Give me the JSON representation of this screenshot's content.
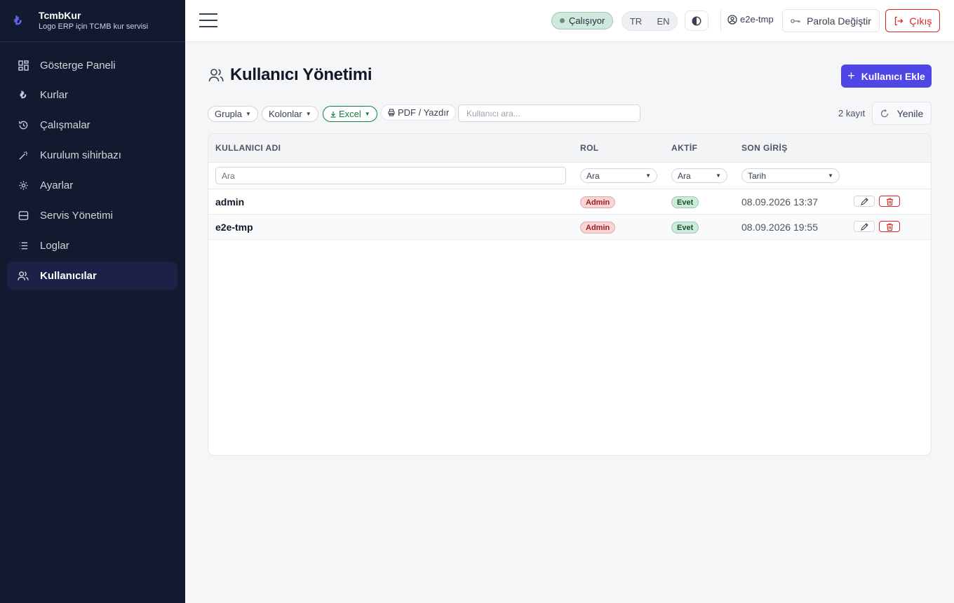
{
  "brand": {
    "logo": "₺",
    "name": "TcmbKur",
    "subtitle": "Logo ERP için TCMB kur servisi"
  },
  "sidebar": {
    "items": [
      {
        "label": "Gösterge Paneli",
        "icon": "dashboard-icon"
      },
      {
        "label": "Kurlar",
        "icon": "lira-icon"
      },
      {
        "label": "Çalışmalar",
        "icon": "history-icon"
      },
      {
        "label": "Kurulum sihirbazı",
        "icon": "wand-icon"
      },
      {
        "label": "Ayarlar",
        "icon": "gear-icon"
      },
      {
        "label": "Servis Yönetimi",
        "icon": "server-icon"
      },
      {
        "label": "Loglar",
        "icon": "list-icon"
      },
      {
        "label": "Kullanıcılar",
        "icon": "users-icon",
        "active": true
      }
    ]
  },
  "header": {
    "status": "Çalışıyor",
    "languages": [
      "TR",
      "EN"
    ],
    "username": "e2e-tmp",
    "change_password": "Parola Değiştir",
    "logout": "Çıkış"
  },
  "page": {
    "title": "Kullanıcı Yönetimi",
    "add_button": "Kullanıcı Ekle"
  },
  "toolbar": {
    "group": "Grupla",
    "columns": "Kolonlar",
    "excel": "Excel",
    "pdf": "PDF / Yazdır",
    "search_placeholder": "Kullanıcı ara...",
    "record_count": "2 kayıt",
    "refresh": "Yenile"
  },
  "table": {
    "headers": {
      "username": "KULLANICI ADI",
      "role": "ROL",
      "active": "AKTİF",
      "last_login": "SON GİRİŞ"
    },
    "filters": {
      "username_placeholder": "Ara",
      "role": "Ara",
      "active": "Ara",
      "last_login": "Tarih"
    },
    "rows": [
      {
        "username": "admin",
        "role": "Admin",
        "active": "Evet",
        "last_login": "08.09.2026 13:37"
      },
      {
        "username": "e2e-tmp",
        "role": "Admin",
        "active": "Evet",
        "last_login": "08.09.2026 19:55"
      }
    ]
  },
  "colors": {
    "accent": "#4f46e5",
    "sidebar_bg": "#111a2e",
    "danger": "#dc2626",
    "success": "#15803d"
  }
}
